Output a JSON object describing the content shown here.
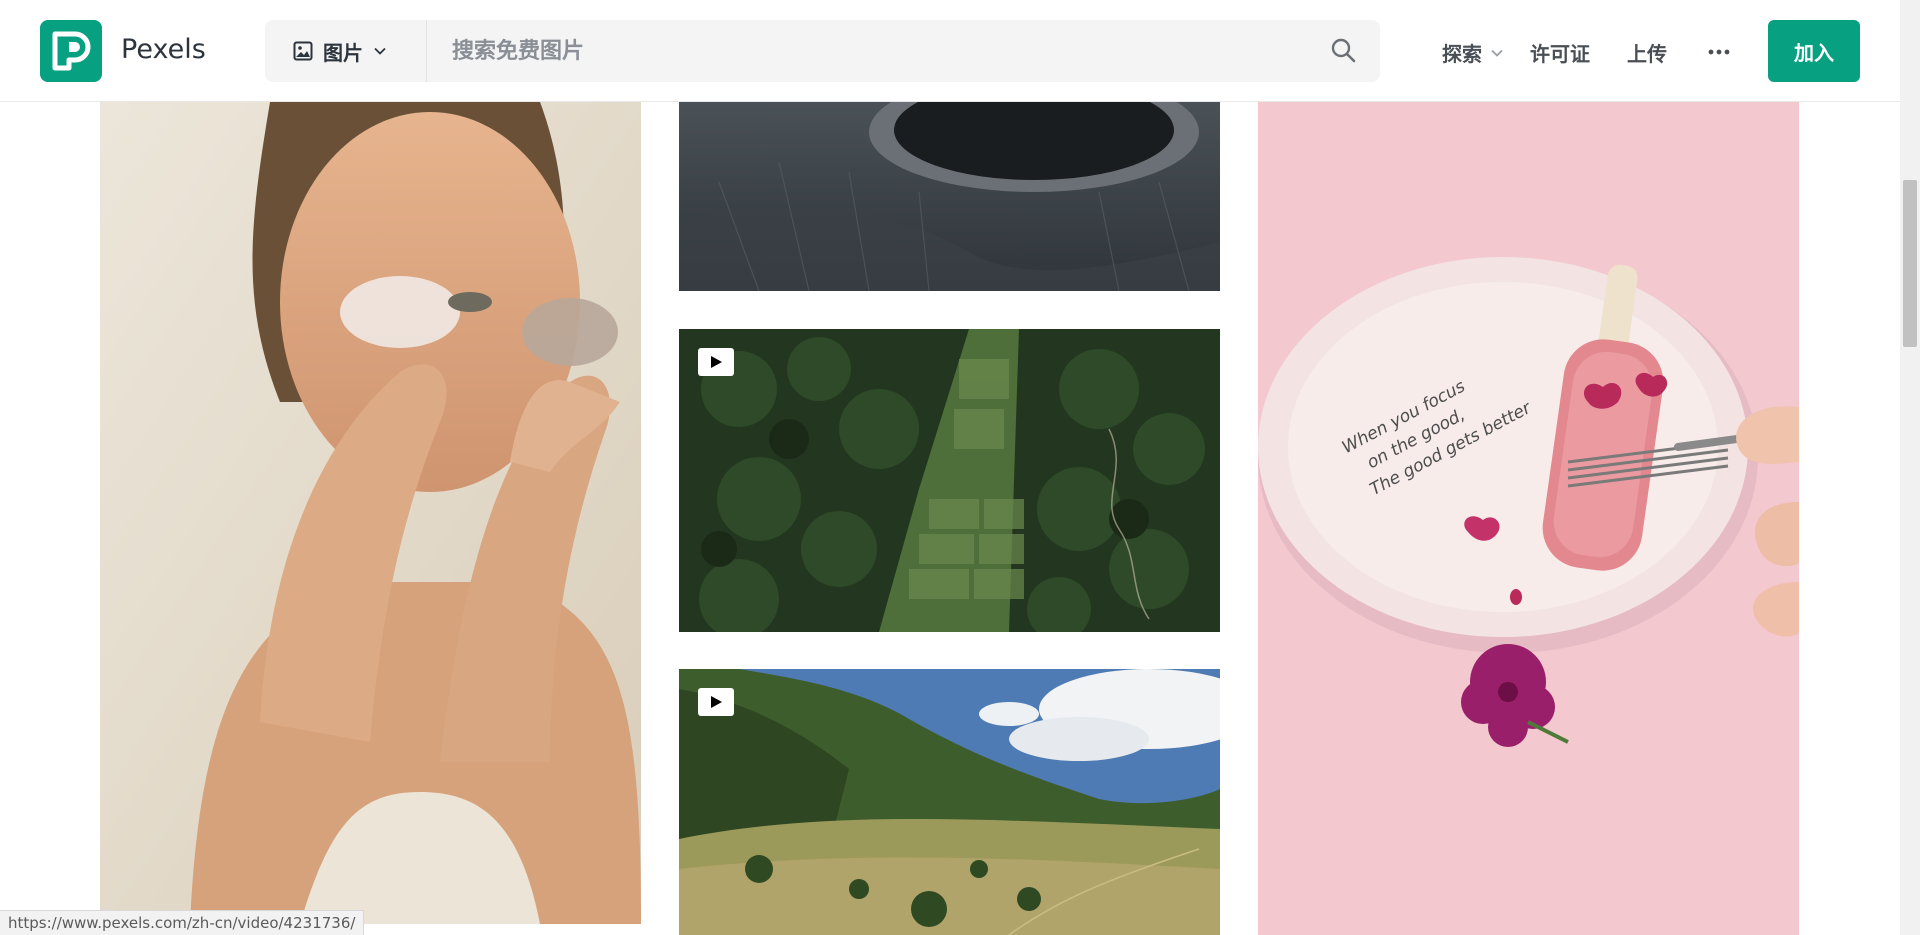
{
  "brand": {
    "name": "Pexels",
    "accent": "#07a081"
  },
  "search": {
    "type_label": "图片",
    "placeholder": "搜索免费图片",
    "type_icon": "image-icon",
    "submit_icon": "search-icon"
  },
  "nav": {
    "explore_label": "探索",
    "license_label": "许可证",
    "upload_label": "上传",
    "more_icon": "more-dots-icon",
    "join_label": "加入"
  },
  "gallery": {
    "tiles": [
      {
        "id": "woman-eye-patches",
        "kind": "photo"
      },
      {
        "id": "volcano-crater",
        "kind": "photo"
      },
      {
        "id": "rice-field-aerial",
        "kind": "video"
      },
      {
        "id": "mountain-valley",
        "kind": "video"
      },
      {
        "id": "pink-popsicle-plate",
        "kind": "photo",
        "plate_text": [
          "When you focus",
          "on the good,",
          "The good gets better"
        ]
      }
    ]
  },
  "status_bar": {
    "url": "https://www.pexels.com/zh-cn/video/4231736/"
  }
}
